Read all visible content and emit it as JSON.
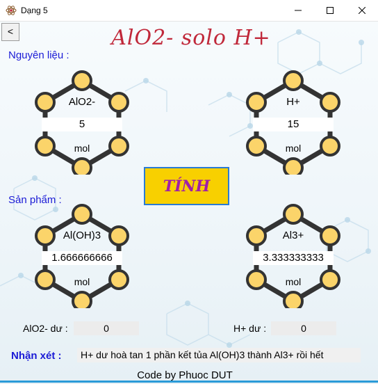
{
  "window": {
    "title": "Dạng 5"
  },
  "back_button": {
    "label": "<"
  },
  "app_title": "AlO2- solo H+",
  "inputs_label": "Nguyên liệu :",
  "products_label": "Sản phẩm :",
  "reactants": [
    {
      "name": "AlO2-",
      "value": "5",
      "unit": "mol"
    },
    {
      "name": "H+",
      "value": "15",
      "unit": "mol"
    }
  ],
  "products": [
    {
      "name": "Al(OH)3",
      "value": "1.666666666",
      "unit": "mol"
    },
    {
      "name": "Al3+",
      "value": "3.333333333",
      "unit": "mol"
    }
  ],
  "calc_button": "TÍNH",
  "excess": [
    {
      "label": "AlO2- dư :",
      "value": "0"
    },
    {
      "label": "H+ dư :",
      "value": "0"
    }
  ],
  "remark_label": "Nhận xét :",
  "remark_text": "H+ dư hoà tan 1 phần kết tủa Al(OH)3 thành Al3+ rồi hết",
  "footer": "Code by Phuoc DUT",
  "colors": {
    "accent_blue": "#1b1bd6",
    "title_red": "#c0283a",
    "button_yellow": "#f8d000",
    "button_text": "#a020a8",
    "node_fill": "#fbd46a"
  }
}
